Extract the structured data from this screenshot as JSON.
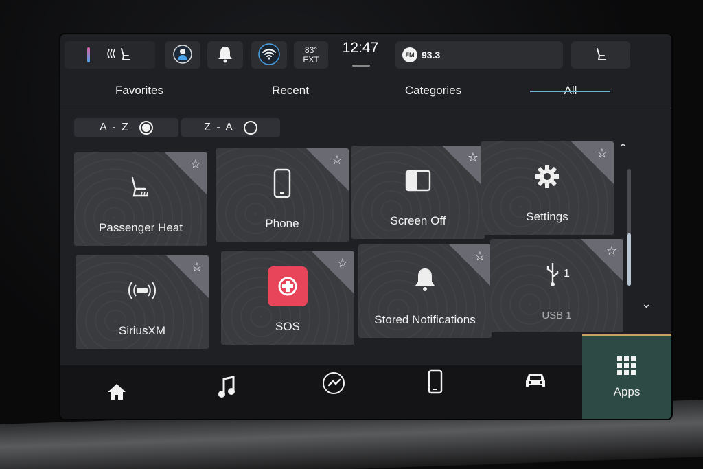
{
  "status_bar": {
    "temp_value": "83°",
    "temp_label": "EXT",
    "time": "12:47",
    "radio_band": "FM",
    "radio_freq": "93.3"
  },
  "tabs": [
    {
      "label": "Favorites"
    },
    {
      "label": "Recent"
    },
    {
      "label": "Categories"
    },
    {
      "label": "All",
      "active": true
    }
  ],
  "sort": {
    "az": "A - Z",
    "za": "Z - A",
    "selected": "A - Z"
  },
  "tiles": [
    {
      "label": "Passenger Heat",
      "icon": "heated-seat-icon"
    },
    {
      "label": "Phone",
      "icon": "phone-icon"
    },
    {
      "label": "Screen Off",
      "icon": "screen-off-icon"
    },
    {
      "label": "Settings",
      "icon": "gear-icon"
    },
    {
      "label": "SiriusXM",
      "icon": "siriusxm-icon"
    },
    {
      "label": "SOS",
      "icon": "sos-icon"
    },
    {
      "label": "Stored Notifications",
      "icon": "bell-icon"
    },
    {
      "label": "USB 1",
      "icon": "usb-icon",
      "badge": "1"
    }
  ],
  "nav": {
    "apps_label": "Apps"
  },
  "colors": {
    "accent": "#6fb3d2",
    "sos": "#e8445a",
    "apps_bg": "#2e4a44"
  }
}
